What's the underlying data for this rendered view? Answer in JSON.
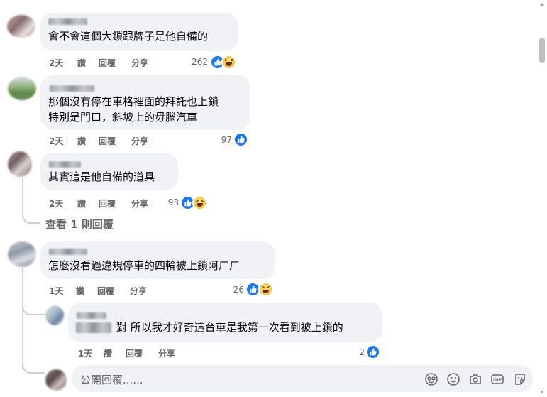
{
  "comments": [
    {
      "text_lines": [
        "會不會這個大鎖跟牌子是他自備的"
      ],
      "actions": {
        "time": "2天",
        "like": "讚",
        "reply": "回覆",
        "share": "分享"
      },
      "reaction_count": "262",
      "reactions": [
        "like-icon",
        "haha-icon"
      ]
    },
    {
      "text_lines": [
        "那個沒有停在車格裡面的拜託也上鎖",
        "特別是門口，斜坡上的毋腦汽車"
      ],
      "actions": {
        "time": "2天",
        "like": "讚",
        "reply": "回覆",
        "share": "分享"
      },
      "reaction_count": "97",
      "reactions": [
        "like-icon"
      ]
    },
    {
      "text_lines": [
        "其實這是他自備的道具"
      ],
      "actions": {
        "time": "2天",
        "like": "讚",
        "reply": "回覆",
        "share": "分享"
      },
      "reaction_count": "93",
      "reactions": [
        "like-icon",
        "haha-icon"
      ],
      "view_replies": "查看 1 則回覆"
    },
    {
      "text_lines": [
        "怎麼沒看過違規停車的四輪被上鎖阿ㄏㄏ"
      ],
      "actions": {
        "time": "1天",
        "like": "讚",
        "reply": "回覆",
        "share": "分享"
      },
      "reaction_count": "26",
      "reactions": [
        "like-icon",
        "haha-icon"
      ],
      "reply": {
        "text_lines": [
          "對 所以我才好奇這台車是我第一次看到被上鎖的"
        ],
        "actions": {
          "time": "1天",
          "like": "讚",
          "reply": "回覆",
          "share": "分享"
        },
        "reaction_count": "2",
        "reactions": [
          "like-icon"
        ]
      }
    }
  ],
  "composer": {
    "placeholder": "公開回覆......",
    "tools": [
      "emoji-sticker-icon",
      "smiley-icon",
      "camera-icon",
      "gif-icon",
      "sticker-icon"
    ]
  },
  "colors": {
    "bubble": "#f0f2f5",
    "like_blue": "#1877f2",
    "meta_gray": "#65676b",
    "thread_line": "#ced0d4"
  }
}
